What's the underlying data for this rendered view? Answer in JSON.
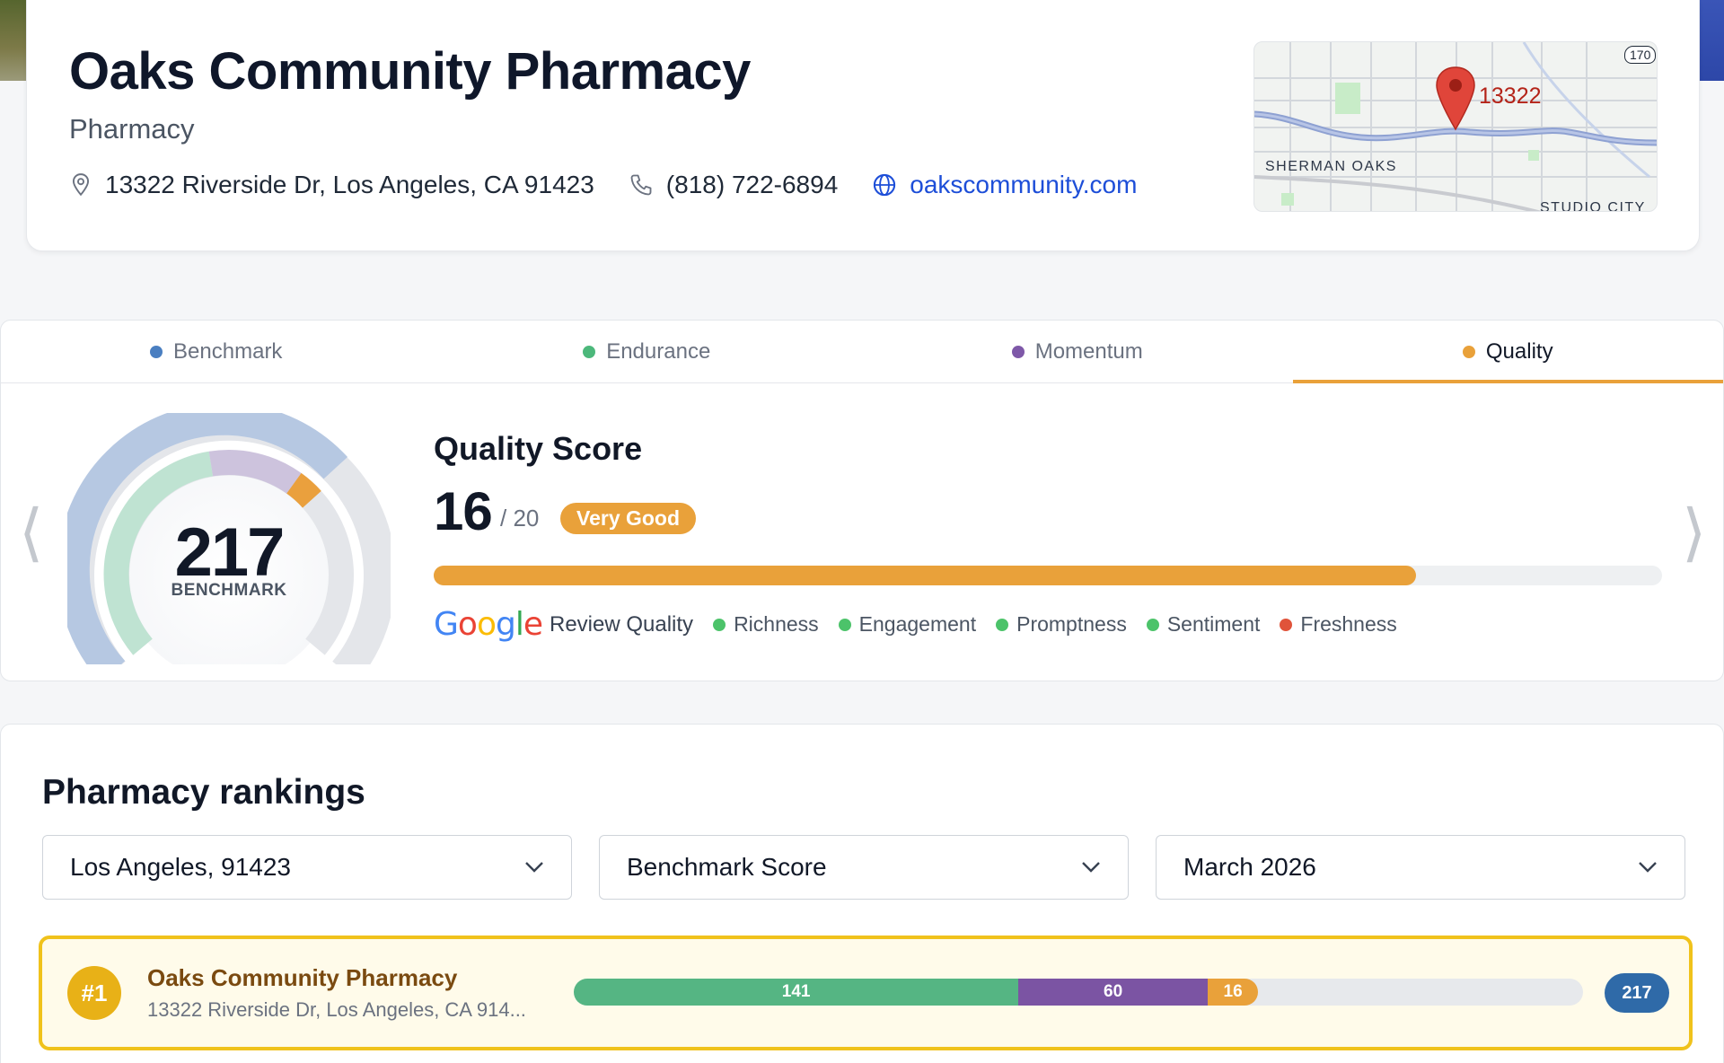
{
  "business": {
    "name": "Oaks Community Pharmacy",
    "type": "Pharmacy",
    "address": "13322 Riverside Dr, Los Angeles, CA 91423",
    "phone": "(818) 722-6894",
    "website": "oakscommunity.com"
  },
  "map": {
    "pin_label": "13322",
    "area_label": "SHERMAN OAKS",
    "area_label_2": "STUDIO CITY",
    "route_shield": "170"
  },
  "tabs": [
    {
      "label": "Benchmark",
      "color": "#4a7fc1",
      "active": false
    },
    {
      "label": "Endurance",
      "color": "#4cb87b",
      "active": false
    },
    {
      "label": "Momentum",
      "color": "#7e58a8",
      "active": false
    },
    {
      "label": "Quality",
      "color": "#e9a13a",
      "active": true
    }
  ],
  "gauge": {
    "value": "217",
    "label": "BENCHMARK",
    "fraction": 1.0
  },
  "quality": {
    "title": "Quality Score",
    "value": "16",
    "max": "/ 20",
    "rating": "Very Good",
    "progress": 0.8,
    "google_label": "Google",
    "review_quality_label": "Review Quality",
    "factors": [
      {
        "label": "Richness",
        "color": "#4cc36a"
      },
      {
        "label": "Engagement",
        "color": "#4cc36a"
      },
      {
        "label": "Promptness",
        "color": "#4cc36a"
      },
      {
        "label": "Sentiment",
        "color": "#4cc36a"
      },
      {
        "label": "Freshness",
        "color": "#e0533a"
      }
    ]
  },
  "rankings": {
    "title": "Pharmacy rankings",
    "filters": {
      "location": "Los Angeles, 91423",
      "metric": "Benchmark Score",
      "period": "March 2026"
    },
    "rows": [
      {
        "rank": "#1",
        "name": "Oaks Community Pharmacy",
        "address": "13322 Riverside Dr, Los Angeles, CA 914...",
        "segments": [
          {
            "label": "141",
            "value": 141,
            "color": "#55b583"
          },
          {
            "label": "60",
            "value": 60,
            "color": "#7b54a3"
          },
          {
            "label": "16",
            "value": 16,
            "color": "#e9a13a"
          }
        ],
        "max": 320,
        "total": "217"
      }
    ]
  }
}
